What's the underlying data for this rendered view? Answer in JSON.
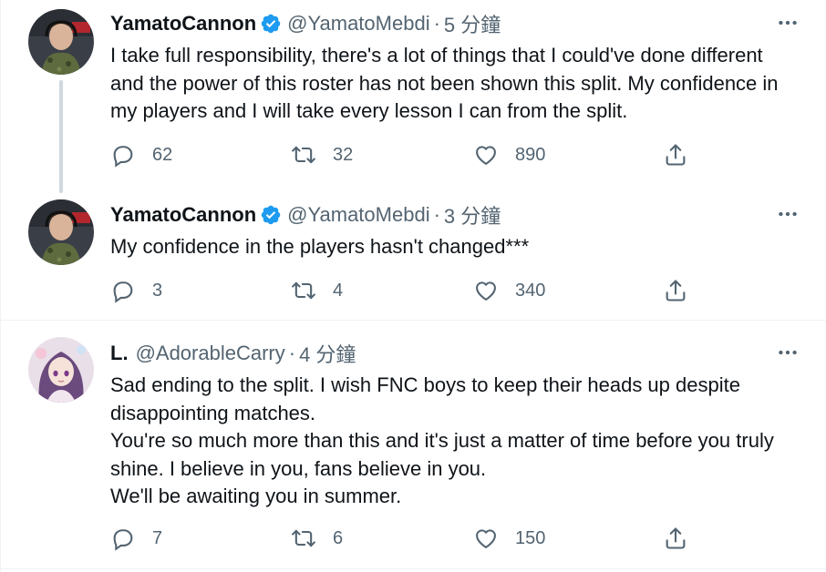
{
  "tweets": [
    {
      "name": "YamatoCannon",
      "verified": true,
      "handle": "@YamatoMebdi",
      "separator": "·",
      "time": "5 分鐘",
      "lines": [
        "I take full responsibility, there's a lot of things that I could've done different",
        "and the power of this roster has not been shown this split. My confidence in",
        "my players and I will take every lesson I can from the split."
      ],
      "replies": "62",
      "retweets": "32",
      "likes": "890"
    },
    {
      "name": "YamatoCannon",
      "verified": true,
      "handle": "@YamatoMebdi",
      "separator": "·",
      "time": "3 分鐘",
      "lines": [
        "My confidence in the players hasn't changed***"
      ],
      "replies": "3",
      "retweets": "4",
      "likes": "340"
    },
    {
      "name": "L.",
      "verified": false,
      "handle": "@AdorableCarry",
      "separator": "·",
      "time": "4 分鐘",
      "lines": [
        "Sad ending to the split. I wish FNC boys to keep their heads up despite",
        "disappointing matches.",
        "You're so much more than this and it's just a matter of time before you truly",
        "shine. I believe in you, fans believe in you.",
        "We'll be awaiting you in summer."
      ],
      "replies": "7",
      "retweets": "6",
      "likes": "150"
    }
  ],
  "colors": {
    "text": "#0f1419",
    "secondary": "#536471",
    "verified": "#1d9bf0",
    "thread_line": "#cfd9de",
    "divider": "#eff3f4"
  },
  "icons": {
    "reply": "reply-icon",
    "retweet": "retweet-icon",
    "like": "like-icon",
    "share": "share-icon",
    "more": "more-icon",
    "verified": "verified-badge-icon"
  }
}
